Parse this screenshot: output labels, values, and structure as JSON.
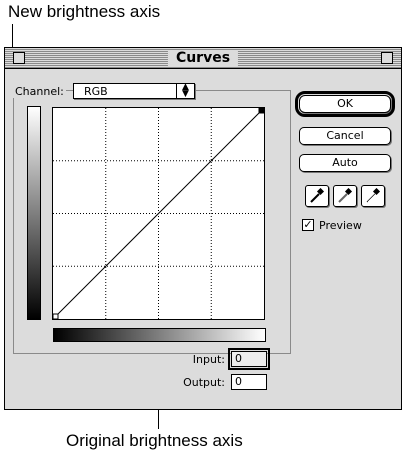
{
  "annotations": {
    "top": "New brightness axis",
    "bottom": "Original brightness axis"
  },
  "window": {
    "title": "Curves"
  },
  "channel": {
    "label": "Channel:",
    "value": "RGB"
  },
  "io": {
    "input_label": "Input:",
    "input_value": "0",
    "output_label": "Output:",
    "output_value": "0"
  },
  "buttons": {
    "ok": "OK",
    "cancel": "Cancel",
    "auto": "Auto"
  },
  "droppers": [
    "black-point-eyedropper-icon",
    "gray-point-eyedropper-icon",
    "white-point-eyedropper-icon"
  ],
  "preview": {
    "label": "Preview",
    "checked": true
  },
  "curve": {
    "points": [
      [
        0,
        0
      ],
      [
        255,
        255
      ]
    ],
    "grid_divisions": 4
  }
}
